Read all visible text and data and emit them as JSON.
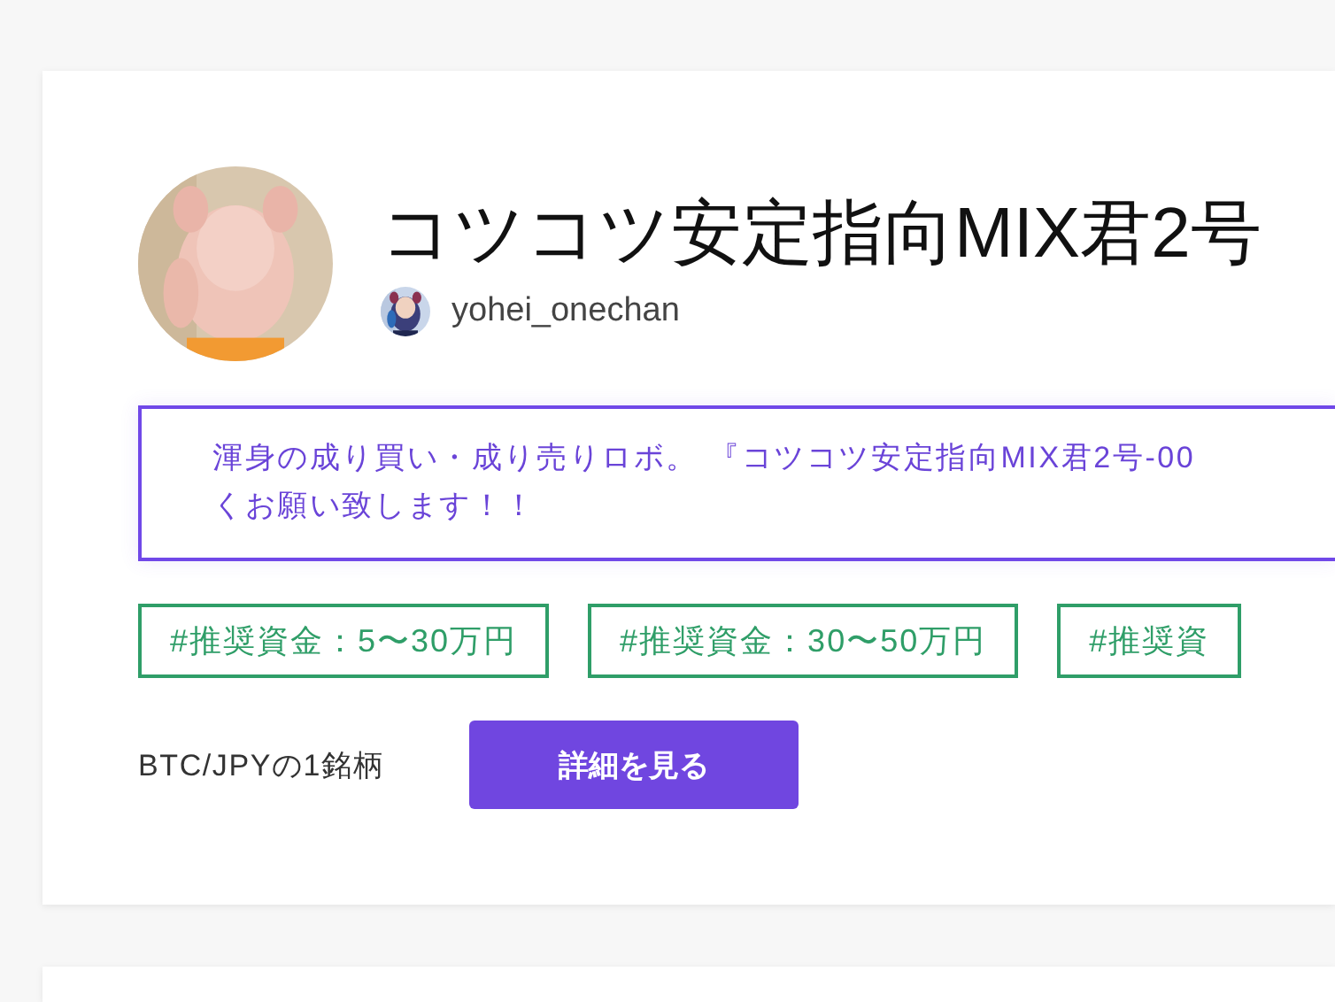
{
  "cards": [
    {
      "avatar": {
        "kind": "picture"
      },
      "title": "コツコツ安定指向MIX君2号",
      "author": {
        "avatar": {
          "kind": "picture"
        },
        "name": "yohei_onechan"
      },
      "description_lines": [
        "渾身の成り買い・成り売りロボ。 『コツコツ安定指向MIX君2号-00",
        "くお願い致します！！"
      ],
      "tags": [
        "#推奨資金：5〜30万円",
        "#推奨資金：30〜50万円",
        "#推奨資"
      ],
      "pairs": "BTC/JPYの1銘柄",
      "button": "詳細を見る"
    }
  ]
}
